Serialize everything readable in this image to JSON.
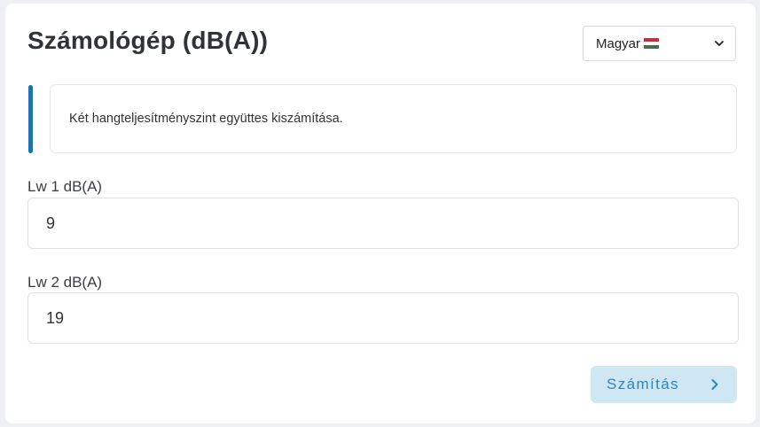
{
  "header": {
    "title": "Számológép (dB(A))"
  },
  "language_select": {
    "selected": "Magyar",
    "flag_icon": "hungarian-flag-icon",
    "flag_colors": [
      "#cd2a3e",
      "#ffffff",
      "#436f4d"
    ]
  },
  "info": {
    "text": "Két hangteljesítményszint együttes kiszámítása."
  },
  "fields": [
    {
      "label": "Lw 1 dB(A)",
      "value": "9"
    },
    {
      "label": "Lw 2 dB(A)",
      "value": "19"
    }
  ],
  "actions": {
    "calculate_label": "Számítás",
    "calculate_icon": "chevron-right-icon"
  },
  "colors": {
    "accent": "#1477b3",
    "button_bg": "#cfe6f3",
    "button_text": "#2b86bd"
  }
}
